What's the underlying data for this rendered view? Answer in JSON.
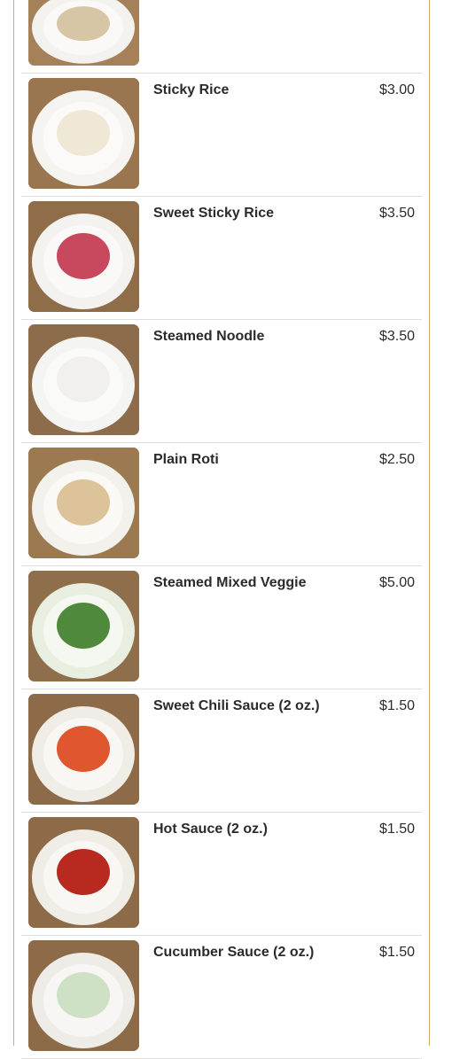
{
  "menu": {
    "items": [
      {
        "name": "",
        "price": "",
        "image": "rice-photo",
        "plate": "#f4f2ee",
        "food": "#d6c6a6",
        "bg": "#a48159"
      },
      {
        "name": "Sticky Rice",
        "price": "$3.00",
        "image": "sticky-rice-photo",
        "plate": "#f5f4f0",
        "food": "#efe8d6",
        "bg": "#9a7650"
      },
      {
        "name": "Sweet Sticky Rice",
        "price": "$3.50",
        "image": "sweet-sticky-rice-photo",
        "plate": "#f3f2ef",
        "food": "#c8485e",
        "bg": "#8e6d48"
      },
      {
        "name": "Steamed Noodle",
        "price": "$3.50",
        "image": "steamed-noodle-photo",
        "plate": "#f4f4f2",
        "food": "#f2f0ec",
        "bg": "#8c6c4a"
      },
      {
        "name": "Plain Roti",
        "price": "$2.50",
        "image": "plain-roti-photo",
        "plate": "#f3f1ec",
        "food": "#dcc39a",
        "bg": "#9b7a52"
      },
      {
        "name": "Steamed Mixed Veggie",
        "price": "$5.00",
        "image": "steamed-mixed-veggie-photo",
        "plate": "#e9efe0",
        "food": "#4f8a3c",
        "bg": "#8f6e4c"
      },
      {
        "name": "Sweet Chili Sauce (2 oz.)",
        "price": "$1.50",
        "image": "sweet-chili-sauce-photo",
        "plate": "#f0ede6",
        "food": "#e0562e",
        "bg": "#8d6b48"
      },
      {
        "name": "Hot Sauce (2 oz.)",
        "price": "$1.50",
        "image": "hot-sauce-photo",
        "plate": "#f0ede6",
        "food": "#b82a1f",
        "bg": "#8d6b48"
      },
      {
        "name": "Cucumber Sauce (2 oz.)",
        "price": "$1.50",
        "image": "cucumber-sauce-photo",
        "plate": "#eeece6",
        "food": "#cfe1c4",
        "bg": "#8d6b48"
      }
    ]
  }
}
